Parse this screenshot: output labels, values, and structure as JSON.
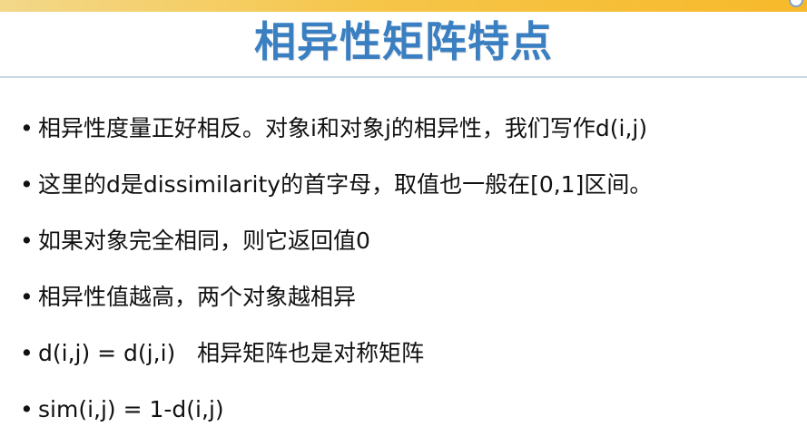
{
  "slide": {
    "title": "相异性矩阵特点",
    "bullets": [
      "相异性度量正好相反。对象i和对象j的相异性，我们写作d(i,j)",
      "这里的d是dissimilarity的首字母，取值也一般在[0,1]区间。",
      "如果对象完全相同，则它返回值0",
      "相异性值越高，两个对象越相异",
      "d(i,j) = d(j,i)   相异矩阵也是对称矩阵",
      "sim(i,j) = 1-d(i,j)"
    ],
    "bullet_glyph": "•",
    "colors": {
      "title": "#3a7fc1",
      "top_bar": "#f6c64a",
      "text": "#111111"
    }
  }
}
